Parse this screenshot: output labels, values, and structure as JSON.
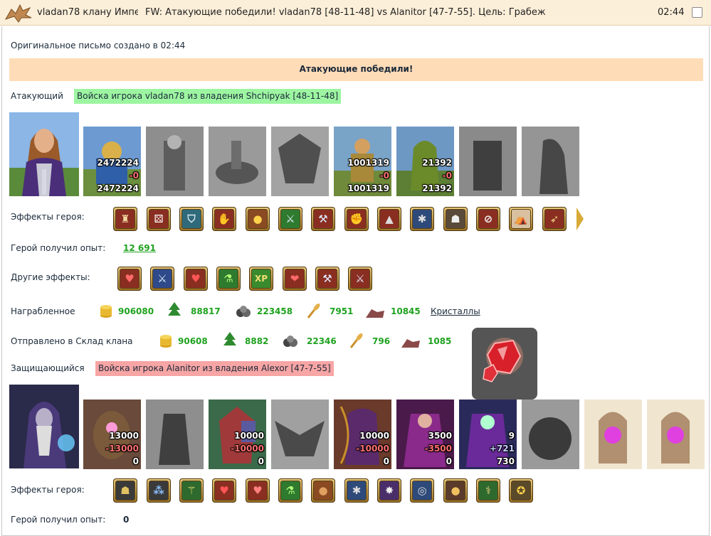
{
  "header": {
    "sender": "vladan78 клану Импе",
    "subject": "FW: Атакующие победили! vladan78 [48-11-48] vs Alanitor [47-7-55]. Цель: Грабеж",
    "time": "02:44"
  },
  "created_text": "Оригинальное письмо создано в 02:44",
  "result_banner": "Атакующие победили!",
  "attacker": {
    "label": "Атакующий",
    "army_text": "Войска игрока vladan78 из владения Shchipyak [48-11-48]",
    "units": [
      {
        "top": "2472224",
        "loss": "-0",
        "bottom": "2472224",
        "icon": "cavalry-knight"
      },
      {
        "icon": "swordsman-gray"
      },
      {
        "icon": "horse-rider-gray"
      },
      {
        "icon": "pegasus-gray"
      },
      {
        "top": "1001319",
        "loss": "-0",
        "bottom": "1001319",
        "icon": "crossbowman"
      },
      {
        "top": "21392",
        "loss": "-0",
        "bottom": "21392",
        "icon": "monk"
      },
      {
        "icon": "dark-warrior-gray"
      },
      {
        "icon": "reaper-gray"
      }
    ],
    "effects_label": "Эффекты героя:",
    "effects": [
      "tower-icon",
      "dice-icon",
      "shield-icon",
      "hand-shield-icon",
      "coins-icon",
      "sword-icon",
      "axe-icon",
      "fist-icon",
      "helmet-icon",
      "web-icon",
      "armor-icon",
      "crossed-icon",
      "tent-icon",
      "bow-icon"
    ],
    "exp_label": "Герой получил опыт:",
    "exp_value": "12 691",
    "other_label": "Другие эффекты:",
    "other_effects": [
      "bag-heart-icon",
      "sword-icon",
      "heart-icon",
      "potion-icon",
      "xp-icon",
      "hearts-icon",
      "axe-icon",
      "sword-fist-icon"
    ],
    "other_xp_text": "XP",
    "loot_label": "Награбленное",
    "loot": [
      {
        "icon": "gold-icon",
        "value": "906080"
      },
      {
        "icon": "wood-icon",
        "value": "88817"
      },
      {
        "icon": "ore-icon",
        "value": "223458"
      },
      {
        "icon": "wheat-icon",
        "value": "7951"
      },
      {
        "icon": "stone-icon",
        "value": "10845"
      }
    ],
    "crystals_link": "Кристаллы",
    "sent_label": "Отправлено в Склад клана",
    "sent": [
      {
        "icon": "gold-icon",
        "value": "90608"
      },
      {
        "icon": "wood-icon",
        "value": "8882"
      },
      {
        "icon": "ore-icon",
        "value": "22346"
      },
      {
        "icon": "wheat-icon",
        "value": "796"
      },
      {
        "icon": "stone-icon",
        "value": "1085"
      }
    ]
  },
  "defender": {
    "label": "Защищающийся",
    "army_text": "Войска игрока Alanitor из владения Alexor [47-7-55]",
    "units": [
      {
        "top": "13000",
        "loss": "-13000",
        "bottom": "0",
        "icon": "golem"
      },
      {
        "icon": "assassin-gray"
      },
      {
        "top": "10000",
        "loss": "-10000",
        "bottom": "0",
        "icon": "lizard-warrior"
      },
      {
        "icon": "gargoyle-gray"
      },
      {
        "top": "10000",
        "loss": "-10000",
        "bottom": "0",
        "icon": "dark-archer"
      },
      {
        "top": "3500",
        "loss": "-3500",
        "bottom": "0",
        "icon": "dark-priestess"
      },
      {
        "top": "9",
        "gain": "+721",
        "bottom": "730",
        "icon": "lich"
      },
      {
        "icon": "spider-gray"
      },
      {
        "icon": "portal-crystal"
      },
      {
        "icon": "portal-crystal"
      }
    ],
    "effects_label": "Эффекты героя:",
    "effects": [
      "armor-gold-icon",
      "shield-dots-icon",
      "wand-icon",
      "heart-icon",
      "heart-hand-icon",
      "potion-icon",
      "bag-icon",
      "web-icon",
      "spider-icon",
      "ring-icon",
      "bag-gold-icon",
      "staff-icon",
      "medal-icon"
    ],
    "exp_label": "Герой получил опыт:",
    "exp_value": "0"
  },
  "tooltip_icon": "red-crystals-icon",
  "colors": {
    "header_bg": "#fcefd9",
    "banner_bg": "#ffdcb8",
    "attacker_tag": "#9df5a1",
    "defender_tag": "#f7a5a5",
    "value_green": "#1fa21f"
  }
}
